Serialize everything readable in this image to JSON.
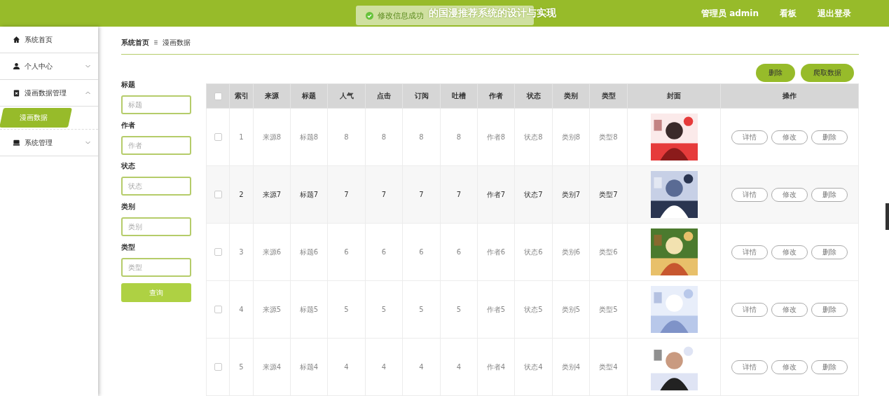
{
  "header": {
    "title": "的国漫推荐系统的设计与实现",
    "user": "管理员 admin",
    "links": [
      "看板",
      "退出登录"
    ]
  },
  "toast": {
    "message": "修改信息成功"
  },
  "sidebar": {
    "items": [
      {
        "label": "系统首页"
      },
      {
        "label": "个人中心",
        "expanded": false
      },
      {
        "label": "漫画数据管理",
        "expanded": true,
        "children": [
          {
            "label": "漫画数据",
            "selected": true
          }
        ]
      },
      {
        "label": "系统管理",
        "expanded": false
      }
    ]
  },
  "breadcrumb": [
    "系统首页",
    "漫画数据"
  ],
  "actions": [
    "删除",
    "爬取数据"
  ],
  "filters": [
    {
      "label": "标题",
      "placeholder": "标题"
    },
    {
      "label": "作者",
      "placeholder": "作者"
    },
    {
      "label": "状态",
      "placeholder": "状态"
    },
    {
      "label": "类别",
      "placeholder": "类别"
    },
    {
      "label": "类型",
      "placeholder": "类型"
    }
  ],
  "search_button": "查询",
  "table": {
    "select_all_checked": false,
    "columns": [
      "索引",
      "来源",
      "标题",
      "人气",
      "点击",
      "订阅",
      "吐槽",
      "作者",
      "状态",
      "类别",
      "类型",
      "封面",
      "操作"
    ],
    "rows": [
      {
        "checked": false,
        "highlighted": false,
        "cells": [
          "1",
          "来源8",
          "标题8",
          "8",
          "8",
          "8",
          "8",
          "作者8",
          "状态8",
          "类别8",
          "类型8"
        ],
        "buttons": [
          "详情",
          "修改",
          "删除"
        ]
      },
      {
        "checked": false,
        "highlighted": true,
        "cells": [
          "2",
          "来源7",
          "标题7",
          "7",
          "7",
          "7",
          "7",
          "作者7",
          "状态7",
          "类别7",
          "类型7"
        ],
        "buttons": [
          "详情",
          "修改",
          "删除"
        ]
      },
      {
        "checked": false,
        "highlighted": false,
        "cells": [
          "3",
          "来源6",
          "标题6",
          "6",
          "6",
          "6",
          "6",
          "作者6",
          "状态6",
          "类别6",
          "类型6"
        ],
        "buttons": [
          "详情",
          "修改",
          "删除"
        ]
      },
      {
        "checked": false,
        "highlighted": false,
        "cells": [
          "4",
          "来源5",
          "标题5",
          "5",
          "5",
          "5",
          "5",
          "作者5",
          "状态5",
          "类别5",
          "类型5"
        ],
        "buttons": [
          "详情",
          "修改",
          "删除"
        ]
      },
      {
        "checked": false,
        "highlighted": false,
        "cells": [
          "5",
          "来源4",
          "标题4",
          "4",
          "4",
          "4",
          "4",
          "作者4",
          "状态4",
          "类别4",
          "类型4"
        ],
        "buttons": [
          "详情",
          "修改",
          "删除"
        ]
      }
    ]
  }
}
